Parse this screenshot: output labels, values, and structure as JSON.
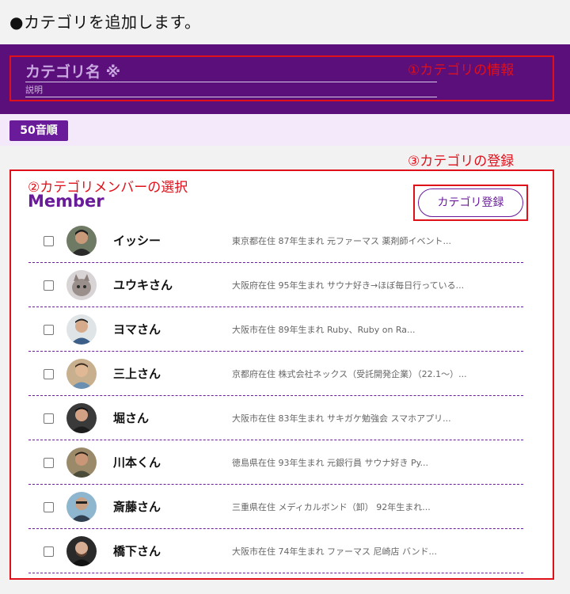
{
  "heading": "●カテゴリを追加します。",
  "form": {
    "category_name_placeholder": "カテゴリ名 ※",
    "description_placeholder": "説明",
    "note": "①カテゴリの情報"
  },
  "sort": {
    "label": "50音順"
  },
  "register": {
    "note": "③カテゴリの登録",
    "button_label": "カテゴリ登録"
  },
  "members": {
    "note": "②カテゴリメンバーの選択",
    "title": "Member",
    "items": [
      {
        "name": "イッシー",
        "bio": "東京都在住 87年生まれ 元ファーマス 薬剤師イベント..."
      },
      {
        "name": "ユウキさん",
        "bio": "大阪府在住 95年生まれ サウナ好き→ほぼ毎日行っている..."
      },
      {
        "name": "ヨマさん",
        "bio": "大阪市在住 89年生まれ Ruby、Ruby on Ra..."
      },
      {
        "name": "三上さん",
        "bio": "京都府在住 株式会社ネックス（受託開発企業）（22.1～）..."
      },
      {
        "name": "堀さん",
        "bio": "大阪市在住 83年生まれ サキガケ勉強会 スマホアプリ..."
      },
      {
        "name": "川本くん",
        "bio": "徳島県在住 93年生まれ 元銀行員 サウナ好き Py..."
      },
      {
        "name": "斎藤さん",
        "bio": "三重県在住 メディカルボンド（卸） 92年生まれ..."
      },
      {
        "name": "橋下さん",
        "bio": "大阪市在住 74年生まれ ファーマス 尼崎店 バンド..."
      }
    ]
  },
  "colors": {
    "brand_purple": "#5a0f7a",
    "accent_purple": "#6a1b9a",
    "annotation_red": "#e0101a",
    "sort_band": "#f3e9fb"
  }
}
